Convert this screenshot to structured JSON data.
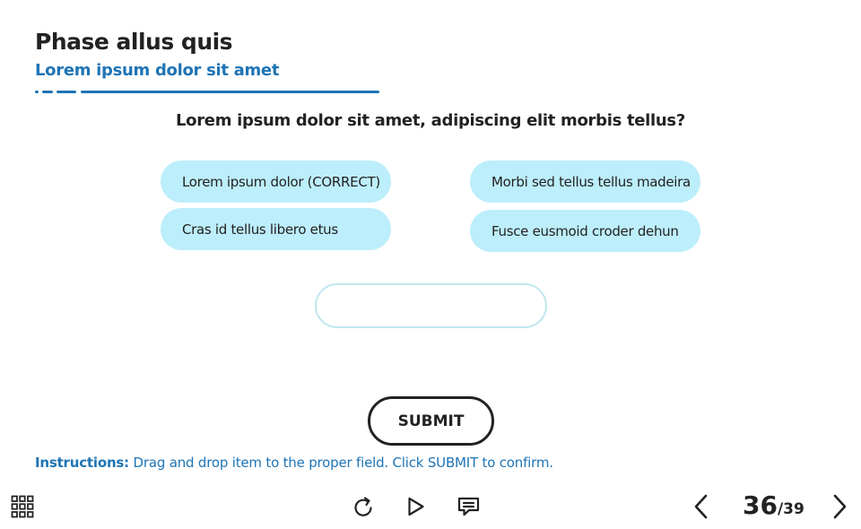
{
  "header": {
    "title": "Phase allus quis",
    "subtitle": "Lorem ipsum dolor sit amet"
  },
  "question": "Lorem ipsum dolor sit amet, adipiscing elit morbis tellus?",
  "options": [
    {
      "label": "Lorem ipsum dolor (CORRECT)"
    },
    {
      "label": "Morbi sed tellus tellus madeira"
    },
    {
      "label": "Cras id tellus libero etus"
    },
    {
      "label": "Fusce eusmoid croder dehun"
    }
  ],
  "dropzone": {
    "value": ""
  },
  "submit_label": "SUBMIT",
  "instructions": {
    "prefix": "Instructions:",
    "text": "Drag and drop item to the proper field. Click SUBMIT to confirm."
  },
  "footer": {
    "menu_icon": "grid-menu-icon",
    "replay_icon": "replay-icon",
    "play_icon": "play-icon",
    "captions_icon": "captions-icon",
    "prev_icon": "chevron-left-icon",
    "next_icon": "chevron-right-icon",
    "current_page": "36",
    "total_pages": "/39"
  },
  "colors": {
    "accent": "#1e74b5",
    "option_bg": "#bdeefb",
    "dropzone_border": "#bfe6ef",
    "text": "#222222"
  }
}
